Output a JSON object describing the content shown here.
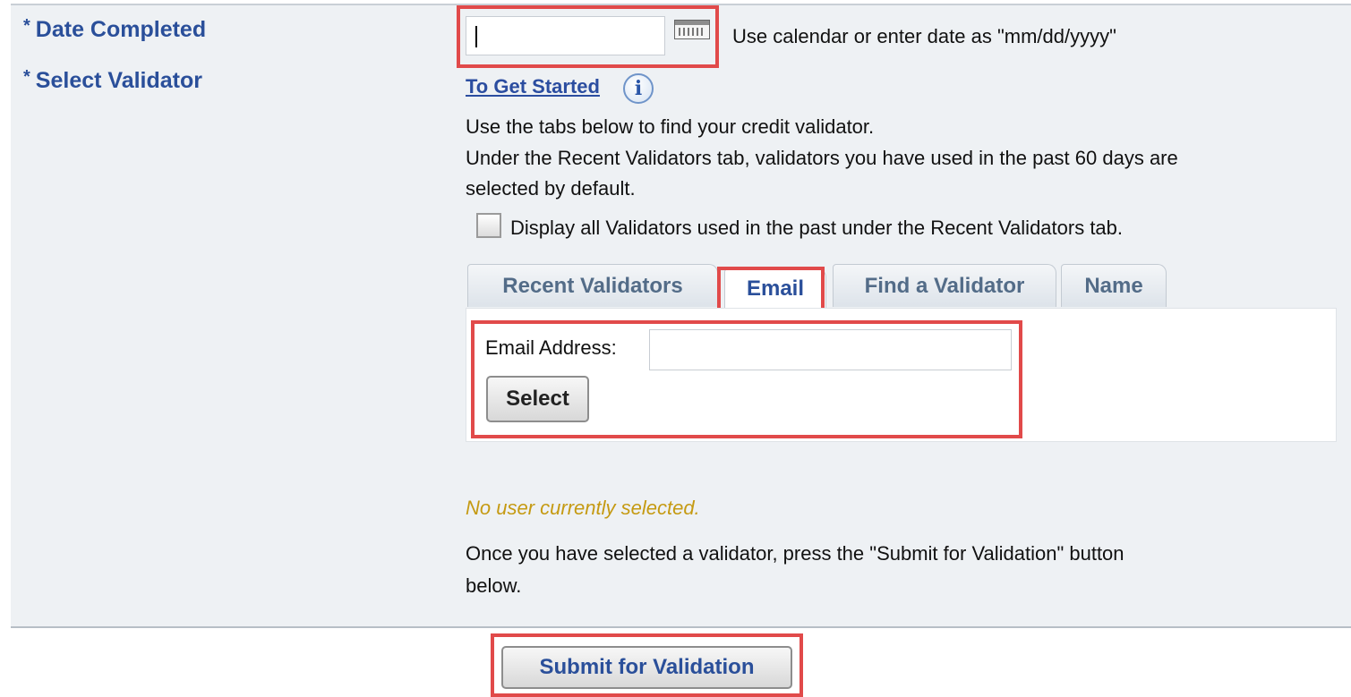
{
  "form": {
    "date_completed_label": "Date Completed",
    "select_validator_label": "Select Validator",
    "required_marker": "*",
    "date_value": "",
    "date_hint": "Use calendar or enter date as \"mm/dd/yyyy\"",
    "get_started_link": "To Get Started",
    "instructions": [
      "Use the tabs below to find your credit validator.",
      "Under the Recent Validators tab, validators you have used in the past 60 days are",
      "selected by default."
    ],
    "checkbox_label": "Display all Validators used in the past under the Recent Validators tab.",
    "checkbox_checked": false
  },
  "tabs": [
    {
      "label": "Recent Validators",
      "active": false
    },
    {
      "label": "Email",
      "active": true
    },
    {
      "label": "Find a Validator",
      "active": false
    },
    {
      "label": "Name",
      "active": false
    }
  ],
  "email_tab": {
    "email_label": "Email Address:",
    "email_value": "",
    "select_button": "Select"
  },
  "status": {
    "no_user": "No user currently selected.",
    "submit_note_line1": "Once you have selected a validator, press the \"Submit for Validation\" button",
    "submit_note_line2": "below."
  },
  "submit_button": "Submit for Validation",
  "colors": {
    "label_blue": "#2a4f9a",
    "highlight_red": "#e14a4a",
    "status_gold": "#c59a12",
    "panel_bg": "#eef1f4"
  },
  "icons": {
    "calendar": "calendar-icon",
    "info": "info-icon"
  }
}
